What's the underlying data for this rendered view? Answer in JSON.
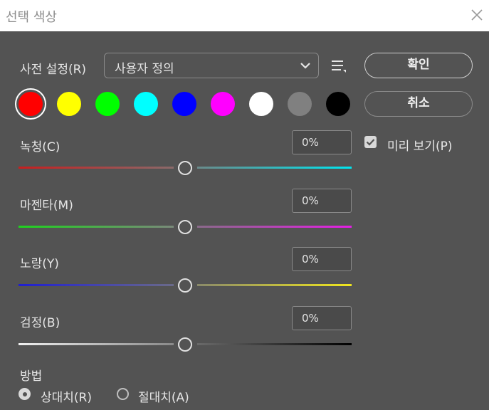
{
  "window": {
    "title": "선택 색상"
  },
  "preset": {
    "label": "사전 설정(R)",
    "value": "사용자 정의"
  },
  "buttons": {
    "ok": "확인",
    "cancel": "취소"
  },
  "swatches": [
    {
      "name": "red",
      "color": "#ff0000",
      "selected": true
    },
    {
      "name": "yellow",
      "color": "#ffff00"
    },
    {
      "name": "green",
      "color": "#00ff00"
    },
    {
      "name": "cyan",
      "color": "#00ffff"
    },
    {
      "name": "blue",
      "color": "#0000ff"
    },
    {
      "name": "magenta",
      "color": "#ff00ff"
    },
    {
      "name": "white",
      "color": "#ffffff"
    },
    {
      "name": "neutral",
      "color": "#808080"
    },
    {
      "name": "black",
      "color": "#000000"
    }
  ],
  "sliders": {
    "cyan": {
      "label": "녹청(C)",
      "value": "0%",
      "level": 0
    },
    "magenta": {
      "label": "마젠타(M)",
      "value": "0%",
      "level": 0
    },
    "yellow": {
      "label": "노랑(Y)",
      "value": "0%",
      "level": 0
    },
    "black": {
      "label": "검정(B)",
      "value": "0%",
      "level": 0
    }
  },
  "preview": {
    "label": "미리 보기(P)",
    "checked": true
  },
  "method": {
    "label": "방법",
    "options": [
      {
        "label": "상대치(R)",
        "selected": true
      },
      {
        "label": "절대치(A)",
        "selected": false
      }
    ]
  },
  "icons": {
    "close": "close-icon",
    "chevron": "chevron-down-icon",
    "menu": "preset-options-icon",
    "check": "checkmark-icon"
  }
}
